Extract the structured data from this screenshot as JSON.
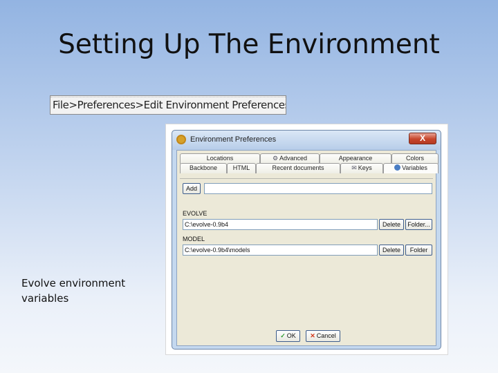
{
  "slide": {
    "title": "Setting Up The Environment",
    "menu_path": "File>Preferences>Edit Environment Preferences",
    "caption": "Evolve environment variables"
  },
  "dialog": {
    "title": "Environment Preferences",
    "close_label": "X",
    "tabs_back": [
      {
        "label": "Locations",
        "icon": ""
      },
      {
        "label": "Advanced",
        "icon": "gear-icon"
      },
      {
        "label": "Appearance",
        "icon": ""
      },
      {
        "label": "Colors",
        "icon": ""
      }
    ],
    "tabs_front": [
      {
        "label": "Backbone",
        "icon": ""
      },
      {
        "label": "HTML",
        "icon": ""
      },
      {
        "label": "Recent documents",
        "icon": ""
      },
      {
        "label": "Keys",
        "icon": "envelope-icon"
      },
      {
        "label": "Variables",
        "icon": "variables-icon",
        "active": true
      }
    ],
    "add_label": "Add",
    "new_variable_value": "",
    "variables": [
      {
        "name": "EVOLVE",
        "value": "C:\\evolve-0.9b4",
        "delete_label": "Delete",
        "folder_label": "Folder..."
      },
      {
        "name": "MODEL",
        "value": "C:\\evolve-0.9b4\\models",
        "delete_label": "Delete",
        "folder_label": "Folder"
      }
    ],
    "ok_label": "OK",
    "cancel_label": "Cancel"
  },
  "colors": {
    "accent": "#3c5c8c",
    "close": "#c7462c"
  }
}
